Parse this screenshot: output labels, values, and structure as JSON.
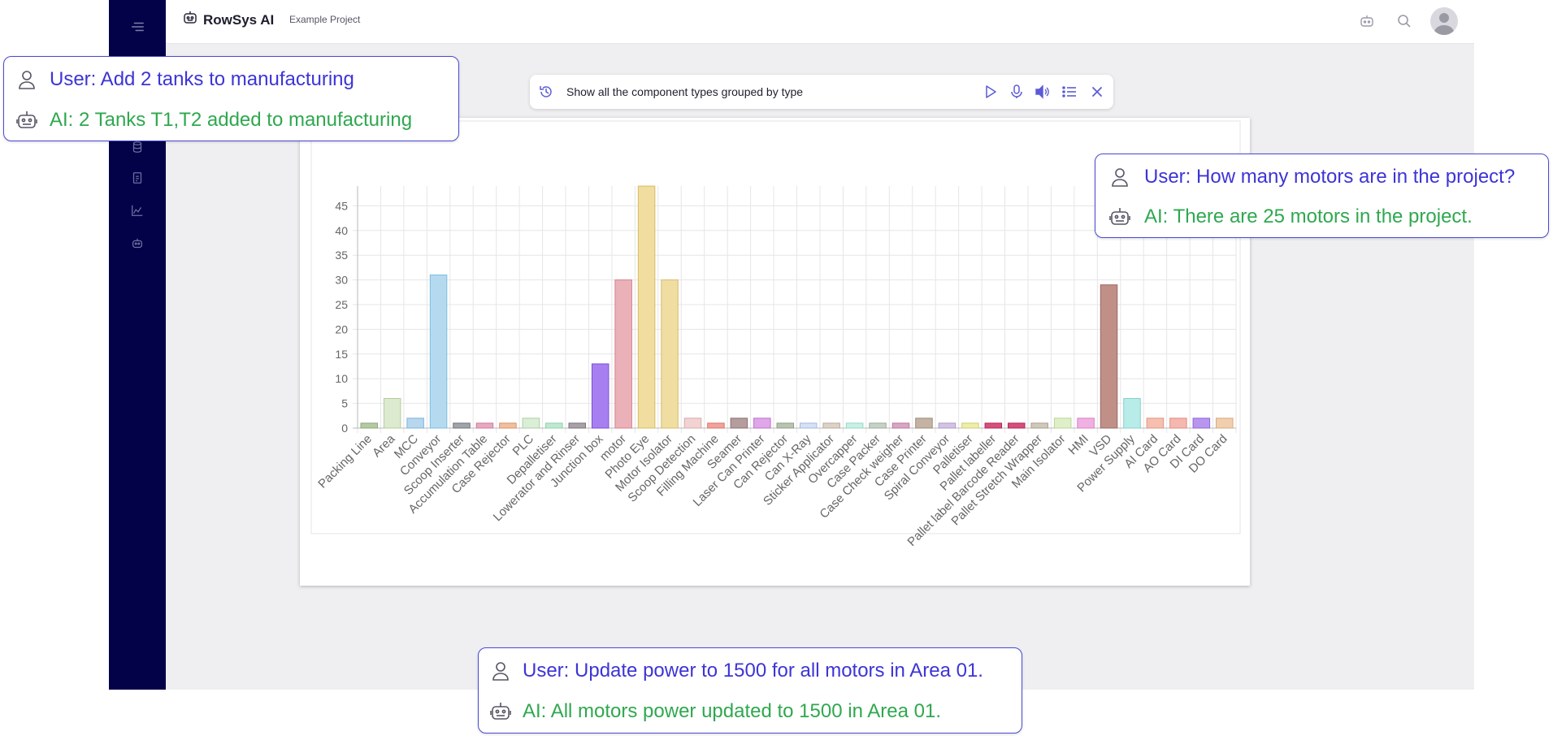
{
  "app": {
    "brand": "RowSys AI",
    "project": "Example Project"
  },
  "command_bar": {
    "query": "Show all the component types grouped by type"
  },
  "callouts": {
    "top_left": {
      "user": "User: Add 2 tanks to manufacturing",
      "ai": "AI: 2 Tanks T1,T2 added to manufacturing"
    },
    "right": {
      "user": "User: How many motors are in the project?",
      "ai": "AI: There are 25 motors in the project."
    },
    "bottom": {
      "user": "User: Update power to 1500 for all motors in Area 01.",
      "ai": "AI: All motors power updated to 1500 in Area 01."
    }
  },
  "icons": {
    "sidebar": [
      "menu-icon",
      "database-icon",
      "report-icon",
      "chart-icon",
      "robot-icon"
    ],
    "topbar": [
      "robot-icon",
      "search-icon",
      "avatar"
    ],
    "command_bar": [
      "history-icon",
      "play-icon",
      "microphone-icon",
      "speaker-icon",
      "list-icon",
      "close-icon"
    ]
  },
  "colors": {
    "sidebar": "#030249",
    "user_text": "#3d34d6",
    "ai_text": "#2fa84f",
    "callout_border": "#4a4ad6"
  },
  "chart_data": {
    "type": "bar",
    "ylim": [
      0,
      49
    ],
    "yticks": [
      0,
      5,
      10,
      15,
      20,
      25,
      30,
      35,
      40,
      45
    ],
    "grid": true,
    "categories": [
      "Packing Line",
      "Area",
      "MCC",
      "Conveyor",
      "Scoop Inserter",
      "Accumulation Table",
      "Case Rejector",
      "PLC",
      "Depalletiser",
      "Lowerator and Rinser",
      "Junction box",
      "motor",
      "Photo Eye",
      "Motor Isolator",
      "Scoop Detection",
      "Filling Machine",
      "Seamer",
      "Laser Can Printer",
      "Can Rejector",
      "Can X-Ray",
      "Sticker Applicator",
      "Overcapper",
      "Case Packer",
      "Case Check weigher",
      "Case Printer",
      "Spiral Conveyor",
      "Palletiser",
      "Pallet labeller",
      "Pallet label Barcode Reader",
      "Pallet Stretch Wrapper",
      "Main Isolator",
      "HMI",
      "VSD",
      "Power Supply",
      "AI Card",
      "AO Card",
      "DI Card",
      "DO Card"
    ],
    "values": [
      1,
      6,
      2,
      31,
      1,
      1,
      1,
      2,
      1,
      1,
      13,
      30,
      49,
      30,
      2,
      1,
      2,
      2,
      1,
      1,
      1,
      1,
      1,
      1,
      2,
      1,
      1,
      1,
      1,
      1,
      2,
      2,
      29,
      6,
      2,
      2,
      2,
      2
    ],
    "bar_colors": [
      "#b5c9a5",
      "#dcebcf",
      "#b7d7ee",
      "#b5daf0",
      "#a1a5ab",
      "#e7a9c0",
      "#f1bf9e",
      "#dbeed8",
      "#c0e8d0",
      "#a9a1a8",
      "#a87ff0",
      "#ebb1b8",
      "#f0dd9f",
      "#f0dda2",
      "#f2d3d3",
      "#f0a39a",
      "#b59d9d",
      "#e0a6ea",
      "#b8c4b0",
      "#d6e2f4",
      "#dcd2c8",
      "#c8f0e5",
      "#c6d2c6",
      "#d9a6c4",
      "#c4b3a3",
      "#d4c4e4",
      "#eeeea8",
      "#d4507a",
      "#d4507a",
      "#d0c8b8",
      "#dff0c8",
      "#f0b0e2",
      "#c09088",
      "#b8ece8",
      "#f6c0b0",
      "#f5b8b0",
      "#b896ee",
      "#f0cfb0"
    ],
    "border_colors": [
      "#8fa77a",
      "#b4ce9e",
      "#7eb3da",
      "#7cbde0",
      "#6f747b",
      "#d0799a",
      "#d9926a",
      "#a9cfa2",
      "#8fcfaa",
      "#7a7079",
      "#7a4ed6",
      "#d5808b",
      "#d6bd62",
      "#d6bd68",
      "#d9a9a9",
      "#d9756b",
      "#8d6f6f",
      "#bc72cc",
      "#8f9d87",
      "#a7b8dd",
      "#b9aa9c",
      "#97d6c6",
      "#9cab9c",
      "#bb77a0",
      "#9d8a78",
      "#ad99c8",
      "#cfcf76",
      "#b32456",
      "#b32456",
      "#a99f8e",
      "#b8d59a",
      "#d881c4",
      "#9a6860",
      "#86d1cc",
      "#e4937f",
      "#e28b80",
      "#9168d6",
      "#d9a87c"
    ]
  }
}
